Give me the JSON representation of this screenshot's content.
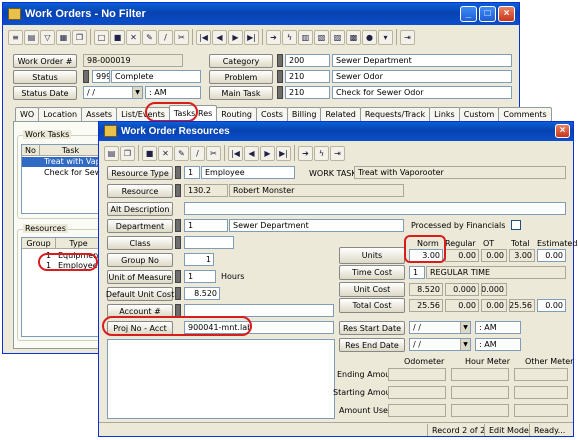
{
  "main": {
    "title": "Work Orders - No Filter",
    "fields": {
      "work_order_label": "Work Order #",
      "work_order_value": "98-000019",
      "status_label": "Status",
      "status_code": "999",
      "status_value": "Complete",
      "status_date_label": "Status Date",
      "status_date_value": "/ /",
      "status_time_value": ": AM",
      "category_label": "Category",
      "category_code": "200",
      "category_value": "Sewer Department",
      "problem_label": "Problem",
      "problem_code": "210",
      "problem_value": "Sewer Odor",
      "main_task_label": "Main Task",
      "main_task_code": "210",
      "main_task_value": "Check for Sewer Odor"
    },
    "tabs": [
      "WO",
      "Location",
      "Assets",
      "List/Events",
      "Tasks/Res",
      "Routing",
      "Costs",
      "Billing",
      "Related",
      "Requests/Track",
      "Links",
      "Custom",
      "Comments"
    ],
    "work_tasks": {
      "title": "Work Tasks",
      "col_no": "No",
      "col_task": "Task",
      "rows": [
        "Treat with Vapor",
        "Check for Sewer"
      ]
    },
    "resources": {
      "title": "Resources",
      "col_group": "Group",
      "col_type": "Type",
      "rows": [
        {
          "group": "1",
          "type": "Equipment"
        },
        {
          "group": "1",
          "type": "Employee"
        }
      ]
    }
  },
  "dialog": {
    "title": "Work Order Resources",
    "resource_type_label": "Resource Type",
    "resource_type_code": "1",
    "resource_type_value": "Employee",
    "work_task_label": "WORK TASK:",
    "work_task_value": "Treat with Vaporooter",
    "resource_label": "Resource",
    "resource_code": "130.2",
    "resource_value": "Robert Monster",
    "alt_description_label": "Alt Description",
    "department_label": "Department",
    "department_code": "1",
    "department_value": "Sewer Department",
    "processed_label": "Processed by Financials",
    "class_label": "Class",
    "group_no_label": "Group No",
    "group_no_value": "1",
    "uom_label": "Unit of Measure",
    "uom_code": "1",
    "uom_value": "Hours",
    "default_unit_cost_label": "Default Unit Cost",
    "default_unit_cost_value": "8.520",
    "account_label": "Account #",
    "proj_label": "Proj No - Acct",
    "proj_value": "900041-mnt.lab",
    "grid": {
      "headers": [
        "Norm",
        "Regular",
        "OT",
        "Total",
        "Estimated"
      ],
      "units_label": "Units",
      "units": [
        "3.00",
        "0.00",
        "0.00",
        "3.00",
        "0.00"
      ],
      "time_cost_label": "Time Cost",
      "time_cost_code": "1",
      "time_cost_value": "REGULAR TIME",
      "unit_cost_label": "Unit Cost",
      "unit_cost": [
        "8.520",
        "0.000",
        "0.000"
      ],
      "total_cost_label": "Total Cost",
      "total_cost": [
        "25.56",
        "0.00",
        "0.00",
        "25.56",
        "0.00"
      ]
    },
    "res_start_label": "Res Start Date",
    "res_start_date": "/ /",
    "res_start_time": ": AM",
    "res_end_label": "Res End Date",
    "res_end_date": "/ /",
    "res_end_time": ": AM",
    "meters": {
      "headers": [
        "Odometer",
        "Hour Meter",
        "Other Meter"
      ],
      "rows": [
        "Ending Amount",
        "Starting Amount",
        "Amount Used"
      ]
    },
    "status": {
      "record": "Record 2 of 2",
      "mode": "Edit Mode",
      "ready": "Ready..."
    }
  },
  "colors": {
    "titlebar": "#0842b0",
    "highlight": "#d81d1d",
    "selection": "#316ac5"
  }
}
